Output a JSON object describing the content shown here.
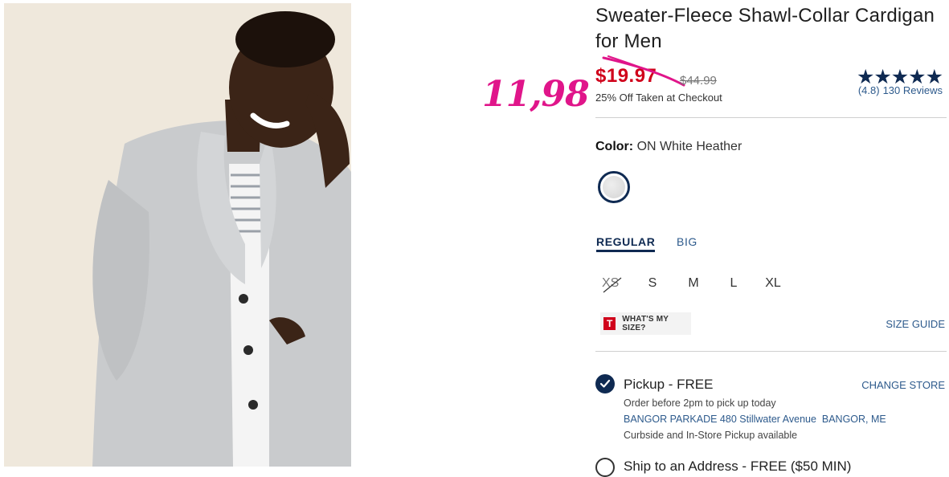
{
  "product": {
    "title": "Sweater-Fleece Shawl-Collar Cardigan for Men",
    "sale_price": "$19.97",
    "regular_price": "$44.99",
    "discount_note": "25% Off Taken at Checkout",
    "rating": {
      "stars": "★★★★★",
      "score": "(4.8)",
      "count": "130 Reviews",
      "value": 4.8,
      "max": 5
    }
  },
  "annotation": {
    "handwritten_price": "11,98",
    "color": "#e0158a"
  },
  "color_selector": {
    "label": "Color:",
    "value": "ON White Heather"
  },
  "fit_tabs": [
    {
      "label": "REGULAR",
      "active": true
    },
    {
      "label": "BIG",
      "active": false
    }
  ],
  "sizes": [
    {
      "label": "XS",
      "available": false
    },
    {
      "label": "S",
      "available": true
    },
    {
      "label": "M",
      "available": true
    },
    {
      "label": "L",
      "available": true
    },
    {
      "label": "XL",
      "available": true
    }
  ],
  "fit_tool": {
    "logo_letter": "T",
    "label": "WHAT'S MY SIZE?"
  },
  "size_guide": "SIZE GUIDE",
  "pickup": {
    "title": "Pickup - FREE",
    "change_store": "CHANGE STORE",
    "order_note": "Order before 2pm to pick up today",
    "store_address": "BANGOR PARKADE 480 Stillwater Avenue  BANGOR, ME",
    "curbside_note": "Curbside and In-Store Pickup available"
  },
  "shipping": {
    "title": "Ship to an Address - FREE ($50 MIN)"
  },
  "colors": {
    "sale": "#d0021b",
    "navy": "#0f2a52",
    "link": "#2d5a8c"
  }
}
